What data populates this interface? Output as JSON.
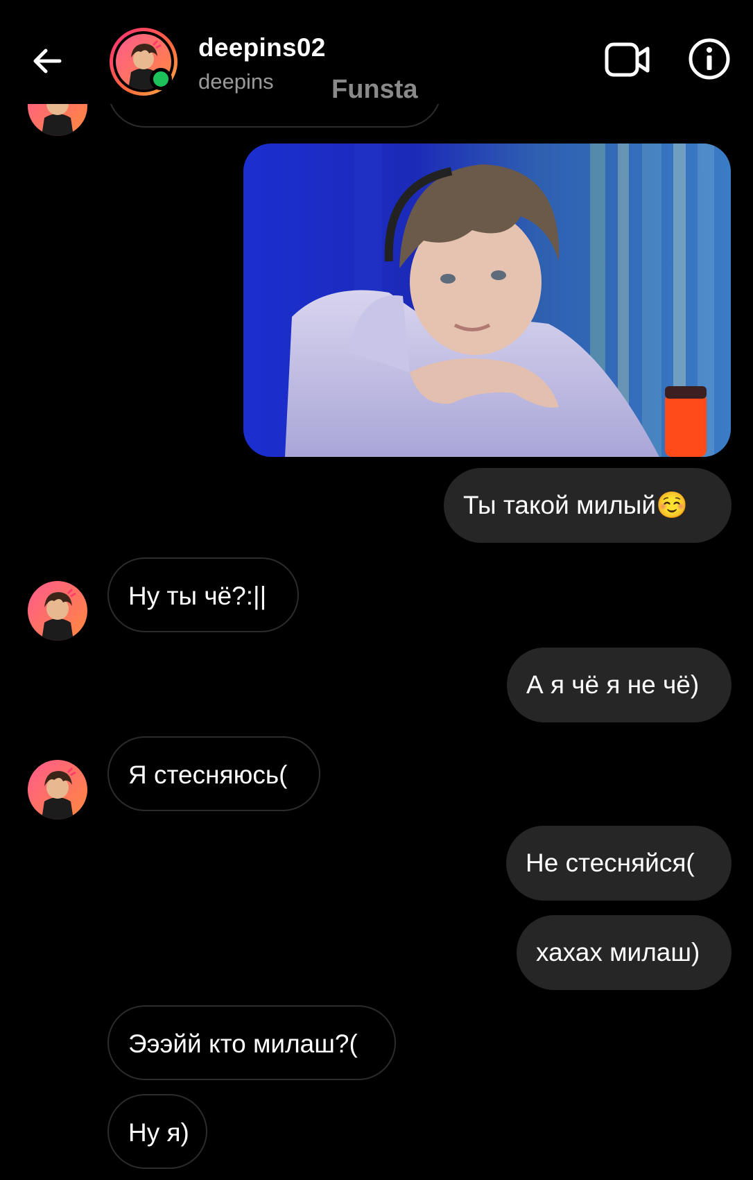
{
  "header": {
    "username": "deepins02",
    "subtitle": "deepins",
    "overlay_text": "Funsta"
  },
  "messages": [
    {
      "side": "out",
      "type": "image"
    },
    {
      "side": "out",
      "text": "Ты такой милый☺️"
    },
    {
      "side": "in",
      "text": "Ну ты чё?:||"
    },
    {
      "side": "out",
      "text": "А я чё я не чё)"
    },
    {
      "side": "in",
      "text": "Я стесняюсь("
    },
    {
      "side": "out",
      "text": "Не стесняйся("
    },
    {
      "side": "out",
      "text": "хахах милаш)"
    },
    {
      "side": "in",
      "text": "Эээйй кто милаш?("
    },
    {
      "side": "in",
      "text": "Ну я)"
    }
  ],
  "colors": {
    "background": "#000000",
    "outgoing_bubble": "#262626",
    "incoming_border": "#2c2c2c",
    "online_dot": "#1ec25a",
    "story_ring": "#ff2d7a"
  },
  "icons": [
    "back-arrow-icon",
    "video-call-icon",
    "info-icon"
  ]
}
